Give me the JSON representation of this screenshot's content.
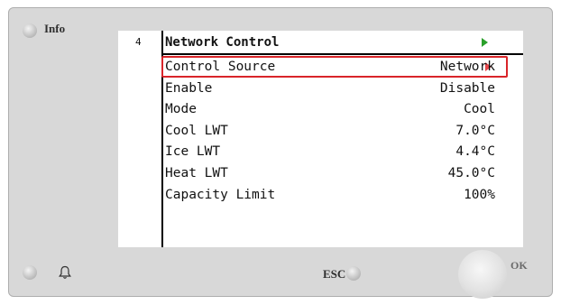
{
  "device": {
    "info_label": "Info",
    "esc_label": "ESC",
    "ok_label": "OK"
  },
  "screen": {
    "page_number": "4",
    "title": "Network Control",
    "selected_index": 0,
    "rows": [
      {
        "label": "Control Source",
        "value": "Network"
      },
      {
        "label": "Enable",
        "value": "Disable"
      },
      {
        "label": "Mode",
        "value": "Cool"
      },
      {
        "label": "Cool LWT",
        "value": "7.0°C"
      },
      {
        "label": "Ice LWT",
        "value": "4.4°C"
      },
      {
        "label": "Heat LWT",
        "value": "45.0°C"
      },
      {
        "label": "Capacity Limit",
        "value": "100%"
      }
    ]
  },
  "colors": {
    "selection": "#d9252a",
    "nav_arrow": "#2aa02a"
  },
  "icons": {
    "info_led": "led-indicator-icon",
    "alarm": "bell-icon",
    "esc_led": "led-indicator-icon",
    "ok": "rotary-knob-icon"
  }
}
